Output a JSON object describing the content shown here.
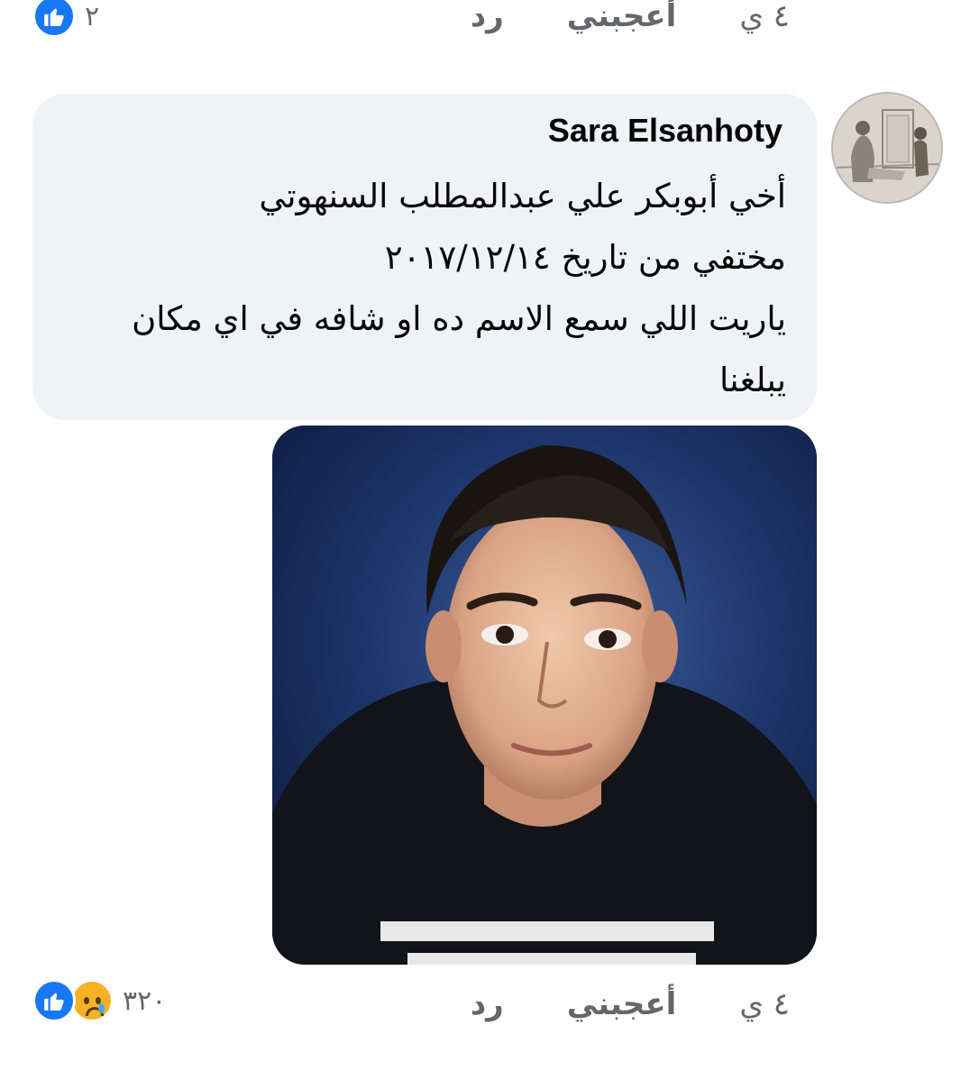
{
  "previous_comment": {
    "reaction_count": "٢",
    "time": "٤ ي",
    "like_label": "أعجبني",
    "reply_label": "رد"
  },
  "comment": {
    "author": "Sara Elsanhoty",
    "lines": [
      "أخي أبوبكر علي عبدالمطلب السنهوتي",
      "مختفي من تاريخ ٢٠١٧/١٢/١٤",
      "ياريت اللي سمع الاسم ده او شافه في اي مكان",
      "يبلغنا"
    ],
    "time": "٤ ي",
    "like_label": "أعجبني",
    "reply_label": "رد",
    "reaction_count": "٣٢٠",
    "reactions": [
      "like-icon",
      "sad-icon"
    ]
  },
  "colors": {
    "bubble": "#f0f2f5",
    "like_blue": "#1877f2",
    "meta_gray": "#65676b",
    "sad_yellow": "#f7b125"
  }
}
